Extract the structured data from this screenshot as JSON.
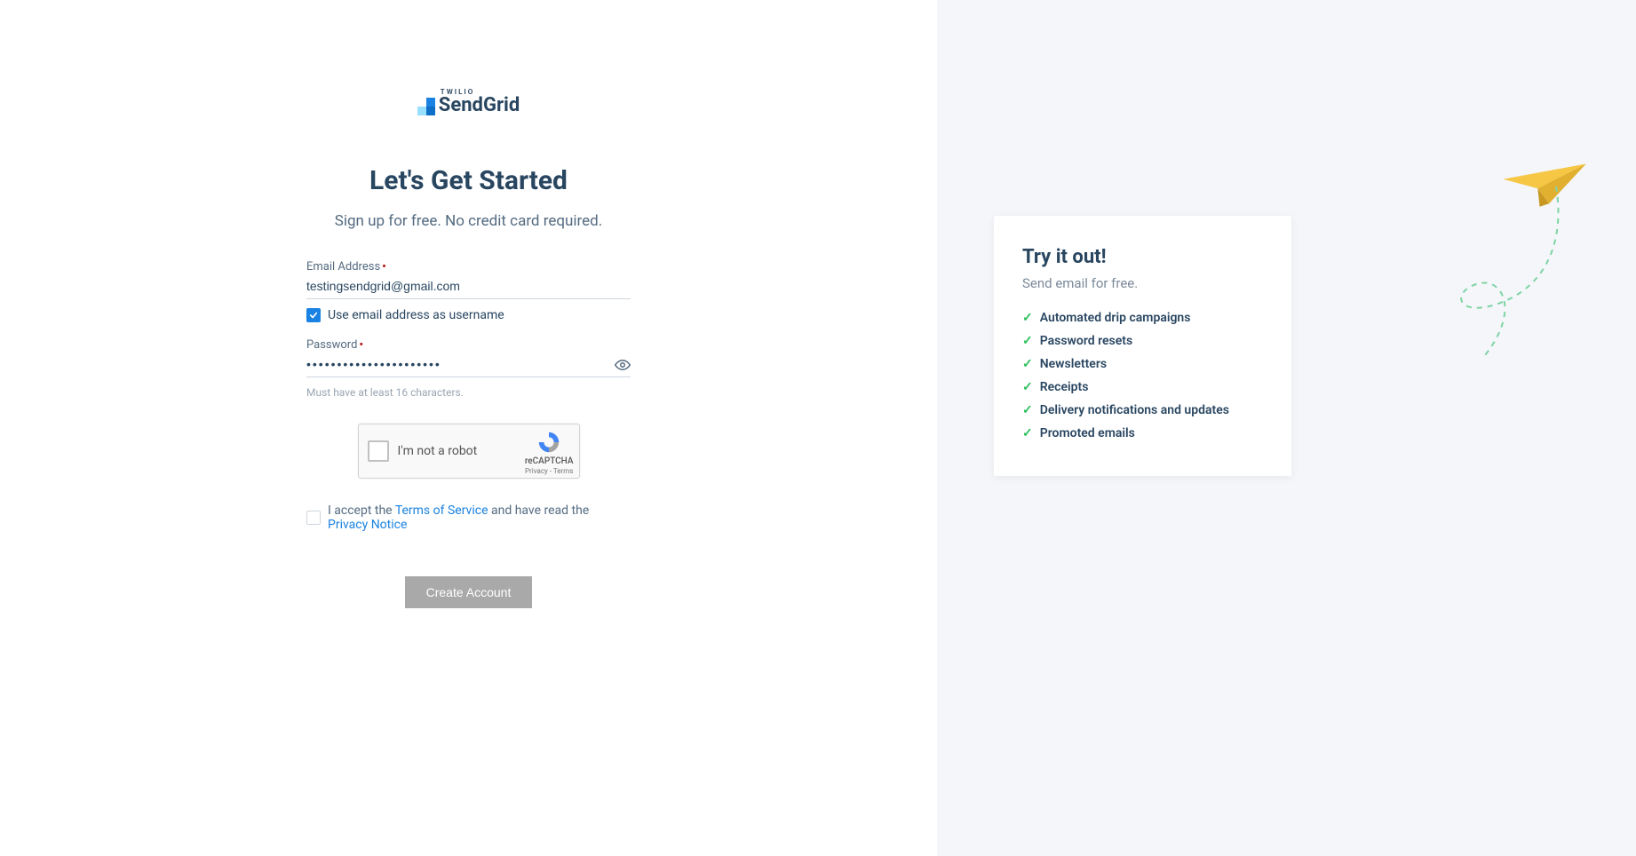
{
  "logo": {
    "twilio": "TWILIO",
    "brand": "SendGrid"
  },
  "heading": "Let's Get Started",
  "subheading": "Sign up for free. No credit card required.",
  "form": {
    "email_label": "Email Address",
    "email_value": "testingsendgrid@gmail.com",
    "use_email_as_username_label": "Use email address as username",
    "use_email_as_username_checked": true,
    "password_label": "Password",
    "password_value": "••••••••••••••••••••••",
    "password_hint": "Must have at least 16 characters.",
    "captcha_label": "I'm not a robot",
    "captcha_brand": "reCAPTCHA",
    "captcha_links": "Privacy - Terms",
    "accept_prefix": "I accept the ",
    "tos_link": "Terms of Service",
    "accept_middle": " and have read the ",
    "privacy_link": "Privacy Notice",
    "accept_checked": false,
    "submit_label": "Create Account"
  },
  "promo": {
    "title": "Try it out!",
    "subtitle": "Send email for free.",
    "items": [
      "Automated drip campaigns",
      "Password resets",
      "Newsletters",
      "Receipts",
      "Delivery notifications and updates",
      "Promoted emails"
    ]
  }
}
